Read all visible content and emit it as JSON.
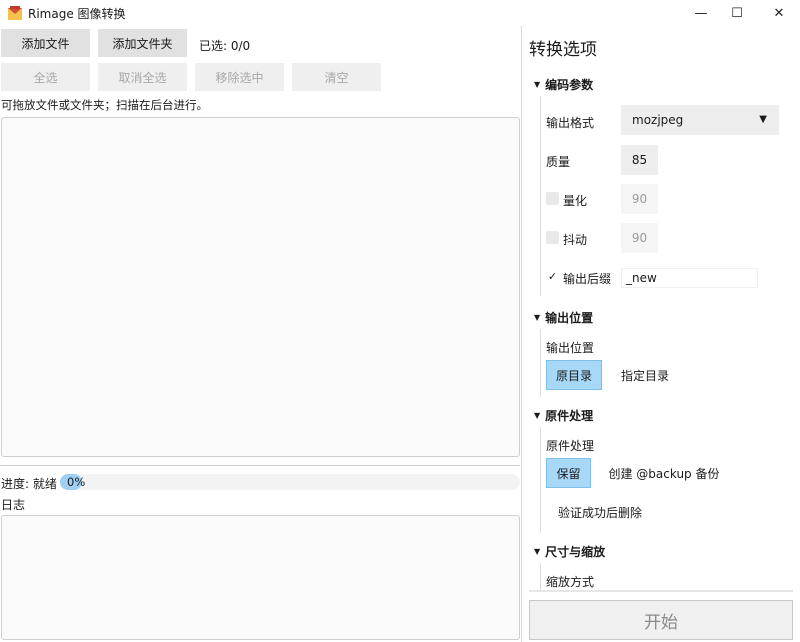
{
  "window": {
    "title": "Rimage 图像转换",
    "minimize_glyph": "—",
    "maximize_glyph": "☐",
    "close_glyph": "✕"
  },
  "toolbar": {
    "add_file": "添加文件",
    "add_folder": "添加文件夹",
    "selected_count": "已选: 0/0",
    "select_all": "全选",
    "deselect_all": "取消全选",
    "remove_selected": "移除选中",
    "clear": "清空"
  },
  "file_area": {
    "hint": "可拖放文件或文件夹；扫描在后台进行。"
  },
  "progress": {
    "label": "进度: 就绪",
    "value_text": "0%",
    "value": 0
  },
  "log": {
    "label": "日志"
  },
  "options": {
    "title": "转换选项",
    "encoding": {
      "header": "编码参数",
      "format_label": "输出格式",
      "format_value": "mozjpeg",
      "quality_label": "质量",
      "quality_value": "85",
      "quantize_label": "量化",
      "quantize_value": "90",
      "quantize_checked": false,
      "dither_label": "抖动",
      "dither_value": "90",
      "dither_checked": false,
      "suffix_label": "输出后缀",
      "suffix_value": "_new",
      "suffix_checked": true
    },
    "output_location": {
      "header": "输出位置",
      "label": "输出位置",
      "original_dir": "原目录",
      "custom_dir": "指定目录"
    },
    "original_handling": {
      "header": "原件处理",
      "label": "原件处理",
      "keep": "保留",
      "backup": "创建 @backup 备份",
      "delete_after_verify": "验证成功后删除"
    },
    "size_scale": {
      "header": "尺寸与缩放",
      "label": "缩放方式"
    },
    "start": "开始"
  },
  "colors": {
    "accent": "#a7d8f7",
    "button_bg": "#e1e1e1"
  }
}
